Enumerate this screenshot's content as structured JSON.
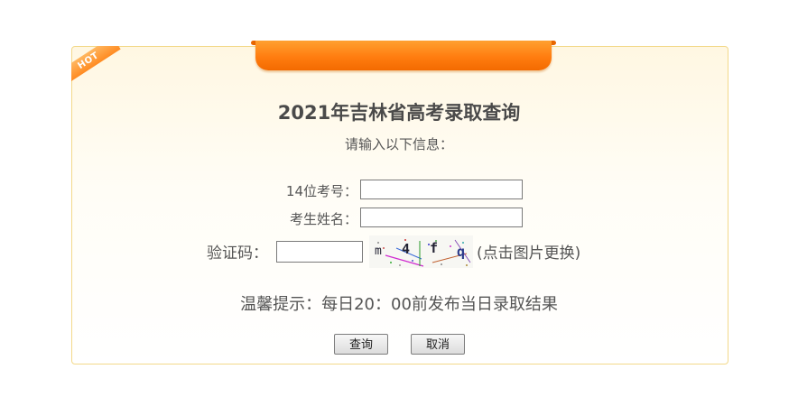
{
  "badge": {
    "text": "HOT"
  },
  "header": {
    "title": "2021年吉林省高考录取查询",
    "subtitle": "请输入以下信息："
  },
  "form": {
    "exam_id": {
      "label": "14位考号：",
      "value": ""
    },
    "name": {
      "label": "考生姓名：",
      "value": ""
    },
    "captcha": {
      "label": "验证码：",
      "value": "",
      "image_chars": [
        "m",
        "4",
        "f",
        "q"
      ],
      "refresh_text": "(点击图片更换)"
    }
  },
  "tip": "温馨提示：每日20：00前发布当日录取结果",
  "buttons": {
    "query": "查询",
    "cancel": "取消"
  },
  "colors": {
    "accent": "#ff7d10",
    "panel_border": "#f3d98a"
  }
}
